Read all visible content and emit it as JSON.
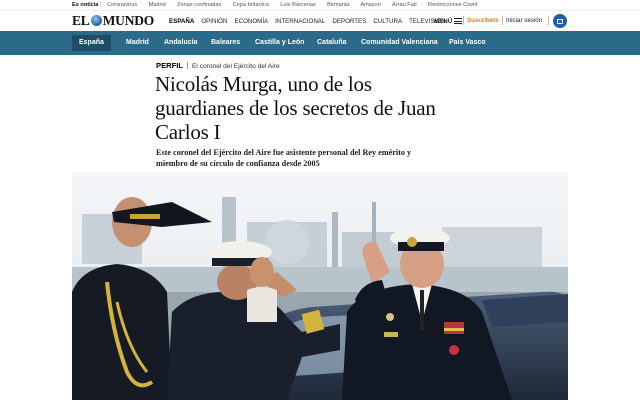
{
  "ticker": {
    "label": "Es noticia",
    "items": [
      "Coronavirus",
      "Madrid",
      "Zonas confinadas",
      "Cepa británica",
      "Luis Bárcenas",
      "Birmania",
      "Amazon",
      "Arrau Fati",
      "Restricciones Covid"
    ]
  },
  "masthead": {
    "logo_left": "EL",
    "logo_right": "MUNDO",
    "nav": [
      "ESPAÑA",
      "OPINIÓN",
      "ECONOMÍA",
      "INTERNACIONAL",
      "DEPORTES",
      "CULTURA",
      "TELEVISIÓN"
    ],
    "menu_label": "MENÚ",
    "subscribe_label": "Suscríbete",
    "login_label": "Iniciar sesión"
  },
  "sections": {
    "items": [
      "España",
      "Madrid",
      "Andalucía",
      "Baleares",
      "Castilla y León",
      "Cataluña",
      "Comunidad Valenciana",
      "País Vasco"
    ]
  },
  "article": {
    "kicker": "PERFIL",
    "kicker_sub": "El coronel del Ejército del Aire",
    "headline": "Nicolás Murga, uno de los guardianes de los secretos de Juan Carlos I",
    "standfirst": "Este coronel del Ejército del Aire fue asistente personal del Rey emérito y miembro de su círculo de confianza desde 2005"
  },
  "colors": {
    "section_bar": "#2a6b89",
    "section_active": "#1c4f67",
    "subscribe": "#d9821c",
    "orbyt_blue": "#1f5ea8"
  }
}
